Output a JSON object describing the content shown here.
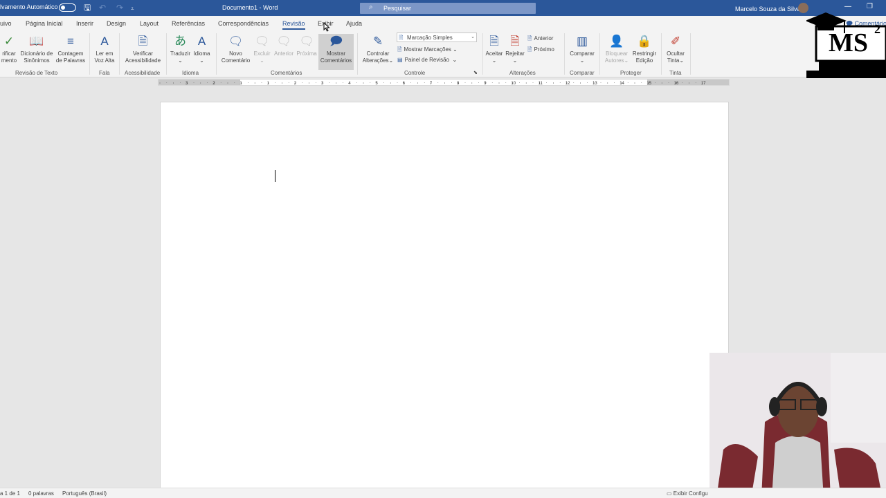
{
  "titlebar": {
    "autosave_label": "lvamento Automático",
    "doc_title": "Documento1 - Word",
    "search_placeholder": "Pesquisar",
    "user_name": "Marcelo Souza da Silva"
  },
  "tabs": [
    {
      "label": "uivo"
    },
    {
      "label": "Página Inicial"
    },
    {
      "label": "Inserir"
    },
    {
      "label": "Design"
    },
    {
      "label": "Layout"
    },
    {
      "label": "Referências"
    },
    {
      "label": "Correspondências"
    },
    {
      "label": "Revisão"
    },
    {
      "label": "Exibir"
    },
    {
      "label": "Ajuda"
    }
  ],
  "comments_button": "Comentários",
  "ribbon": {
    "groups": {
      "revisao_texto": "Revisão de Texto",
      "fala": "Fala",
      "acessibilidade": "Acessibilidade",
      "idioma": "Idioma",
      "comentarios": "Comentários",
      "controle": "Controle",
      "alteracoes": "Alterações",
      "comparar": "Comparar",
      "proteger": "Proteger",
      "tinta": "Tinta"
    },
    "buttons": {
      "verificar_l1": "rificar",
      "verificar_l2": "mento",
      "dicionario_l1": "Dicionário de",
      "dicionario_l2": "Sinônimos",
      "contagem_l1": "Contagem",
      "contagem_l2": "de Palavras",
      "ler_l1": "Ler em",
      "ler_l2": "Voz Alta",
      "acess_l1": "Verificar",
      "acess_l2": "Acessibilidade",
      "traduzir": "Traduzir",
      "idioma": "Idioma",
      "novo_l1": "Novo",
      "novo_l2": "Comentário",
      "excluir": "Excluir",
      "anterior": "Anterior",
      "proxima": "Próxima",
      "mostrar_l1": "Mostrar",
      "mostrar_l2": "Comentários",
      "controlar_l1": "Controlar",
      "controlar_l2": "Alterações",
      "marcacao_simples": "Marcação Simples",
      "mostrar_marcacoes": "Mostrar Marcações",
      "painel_revisao": "Painel de Revisão",
      "aceitar": "Aceitar",
      "rejeitar": "Rejeitar",
      "anterior2": "Anterior",
      "proximo": "Próximo",
      "comparar": "Comparar",
      "bloquear_l1": "Bloquear",
      "bloquear_l2": "Autores",
      "restringir_l1": "Restringir",
      "restringir_l2": "Edição",
      "ocultar_l1": "Ocultar",
      "ocultar_l2": "Tinta"
    }
  },
  "ruler_numbers": [
    "3",
    "2",
    "1",
    "1",
    "2",
    "3",
    "4",
    "5",
    "6",
    "7",
    "8",
    "9",
    "10",
    "11",
    "12",
    "13",
    "14",
    "15",
    "16",
    "17"
  ],
  "logo_text": "MS",
  "logo_sup": "2",
  "statusbar": {
    "page": "a 1 de 1",
    "words": "0 palavras",
    "language": "Português (Brasil)",
    "display_settings": "Exibir Configu"
  },
  "colors": {
    "brand": "#2b579a",
    "ribbon_bg": "#f3f3f3",
    "canvas_bg": "#e6e6e6"
  }
}
